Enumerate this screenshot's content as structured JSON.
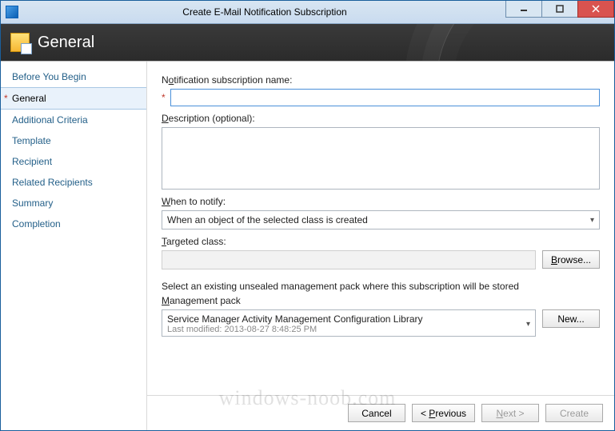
{
  "window": {
    "title": "Create E-Mail Notification Subscription"
  },
  "banner": {
    "heading": "General"
  },
  "sidebar": {
    "items": [
      {
        "label": "Before You Begin"
      },
      {
        "label": "General"
      },
      {
        "label": "Additional Criteria"
      },
      {
        "label": "Template"
      },
      {
        "label": "Recipient"
      },
      {
        "label": "Related Recipients"
      },
      {
        "label": "Summary"
      },
      {
        "label": "Completion"
      }
    ]
  },
  "form": {
    "name_label": "Notification subscription name:",
    "name_underline": "o",
    "name_value": "",
    "desc_label": "Description (optional):",
    "desc_underline": "D",
    "desc_value": "",
    "when_label": "hen to notify:",
    "when_underline": "W",
    "when_value": "When an object of the selected class is created",
    "target_label": "argeted class:",
    "target_underline": "T",
    "target_value": "",
    "browse_label": "Browse...",
    "browse_underline": "B",
    "mp_help": "Select an existing unsealed management pack where this subscription will be stored",
    "mp_label": "anagement pack",
    "mp_underline": "M",
    "mp_value": "Service Manager Activity Management Configuration Library",
    "mp_modified": "Last modified:  2013-08-27 8:48:25 PM",
    "new_label": "New..."
  },
  "footer": {
    "cancel": "Cancel",
    "previous": "< Previous",
    "previous_underline": "P",
    "next": "Next >",
    "next_underline": "N",
    "create": "Create"
  },
  "watermark": "windows-noob.com"
}
